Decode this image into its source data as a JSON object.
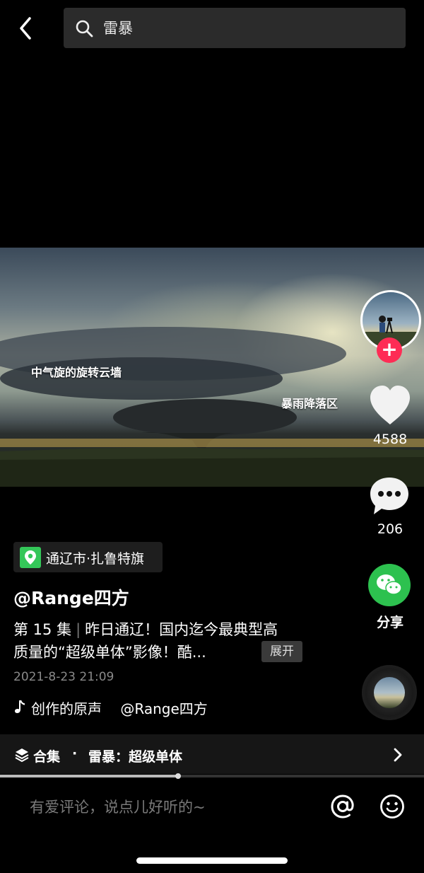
{
  "header": {
    "search_query": "雷暴"
  },
  "video": {
    "caption_left": "中气旋的旋转云墙",
    "caption_right": "暴雨降落区"
  },
  "actions": {
    "follow_symbol": "+",
    "likes": "4588",
    "comments": "206",
    "share_label": "分享"
  },
  "post": {
    "location": "通辽市·扎鲁特旗",
    "author": "@Range四方",
    "episode": "第 15 集",
    "description_line1": "昨日通辽！国内迄今最典型高",
    "description_line2": "质量的“超级单体”影像！酷...",
    "expand_label": "展开",
    "date": "2021-8-23 21:09",
    "music": "创作的原声　 @Range四方"
  },
  "collection": {
    "label": "合集",
    "separator": "·",
    "name": "雷暴：超级单体"
  },
  "playback": {
    "progress_fraction": 0.42
  },
  "comment_bar": {
    "placeholder": "有爱评论，说点儿好听的~"
  },
  "colors": {
    "like_red": "#fe2c55",
    "wechat_green": "#2dc14f",
    "location_green": "#34c759"
  },
  "icons": [
    "back-arrow-icon",
    "search-icon",
    "heart-icon",
    "comment-bubble-icon",
    "wechat-icon",
    "music-note-icon",
    "layers-icon",
    "chevron-right-icon",
    "at-icon",
    "emoji-icon",
    "location-pin-icon"
  ]
}
